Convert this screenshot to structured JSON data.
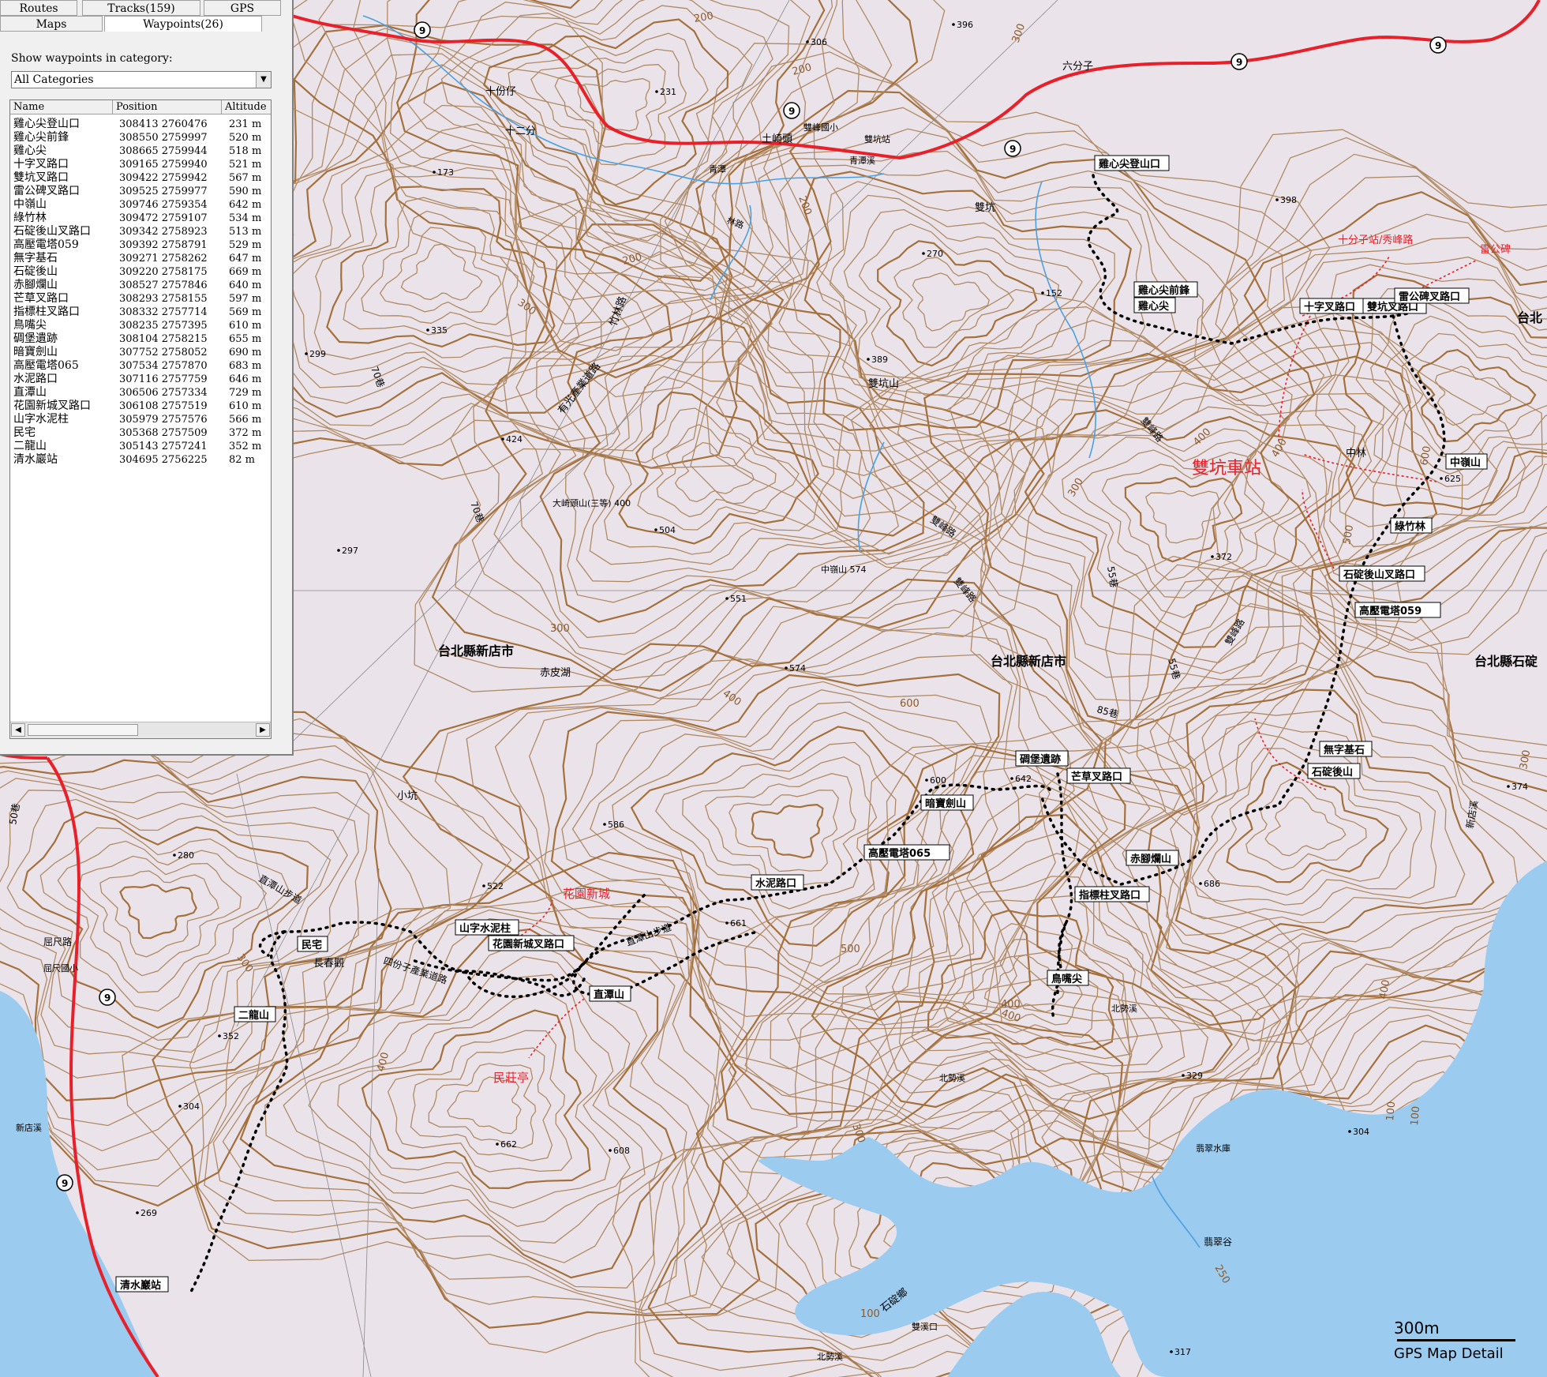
{
  "panel": {
    "tabs_row1": [
      "Routes",
      "Tracks(159)",
      "GPS"
    ],
    "tabs_row2": [
      "Maps",
      "Waypoints(26)"
    ],
    "category_label": "Show waypoints in category:",
    "category_value": "All Categories",
    "columns": [
      "Name",
      "Position",
      "Altitude"
    ],
    "waypoints": [
      {
        "name": "雞心尖登山口",
        "position": "308413 2760476",
        "altitude": "231 m"
      },
      {
        "name": "雞心尖前鋒",
        "position": "308550 2759997",
        "altitude": "520 m"
      },
      {
        "name": "雞心尖",
        "position": "308665 2759944",
        "altitude": "518 m"
      },
      {
        "name": "十字叉路口",
        "position": "309165 2759940",
        "altitude": "521 m"
      },
      {
        "name": "雙坑叉路口",
        "position": "309422 2759942",
        "altitude": "567 m"
      },
      {
        "name": "雷公碑叉路口",
        "position": "309525 2759977",
        "altitude": "590 m"
      },
      {
        "name": "中嶺山",
        "position": "309746 2759354",
        "altitude": "642 m"
      },
      {
        "name": "綠竹林",
        "position": "309472 2759107",
        "altitude": "534 m"
      },
      {
        "name": "石碇後山叉路口",
        "position": "309342 2758923",
        "altitude": "513 m"
      },
      {
        "name": "高壓電塔059",
        "position": "309392 2758791",
        "altitude": "529 m"
      },
      {
        "name": "無字基石",
        "position": "309271 2758262",
        "altitude": "647 m"
      },
      {
        "name": "石碇後山",
        "position": "309220 2758175",
        "altitude": "669 m"
      },
      {
        "name": "赤腳爛山",
        "position": "308527 2757846",
        "altitude": "640 m"
      },
      {
        "name": "芒草叉路口",
        "position": "308293 2758155",
        "altitude": "597 m"
      },
      {
        "name": "指標柱叉路口",
        "position": "308332 2757714",
        "altitude": "569 m"
      },
      {
        "name": "鳥嘴尖",
        "position": "308235 2757395",
        "altitude": "610 m"
      },
      {
        "name": "碉堡遺跡",
        "position": "308104 2758215",
        "altitude": "655 m"
      },
      {
        "name": "暗寶劍山",
        "position": "307752 2758052",
        "altitude": "690 m"
      },
      {
        "name": "高壓電塔065",
        "position": "307534 2757870",
        "altitude": "683 m"
      },
      {
        "name": "水泥路口",
        "position": "307116 2757759",
        "altitude": "646 m"
      },
      {
        "name": "直潭山",
        "position": "306506 2757334",
        "altitude": "729 m"
      },
      {
        "name": "花園新城叉路口",
        "position": "306108 2757519",
        "altitude": "610 m"
      },
      {
        "name": "山字水泥柱",
        "position": "305979 2757576",
        "altitude": "566 m"
      },
      {
        "name": "民宅",
        "position": "305368 2757509",
        "altitude": "372 m"
      },
      {
        "name": "二龍山",
        "position": "305143 2757241",
        "altitude": "352 m"
      },
      {
        "name": "清水巖站",
        "position": "304695 2756225",
        "altitude": "82 m"
      }
    ]
  },
  "map": {
    "colors": {
      "background": "#ebe3ea",
      "contour": "#b08a64",
      "contour_index": "#a4703c",
      "water": "#9ccbf0",
      "highway": "#e8202a",
      "stream": "#4aa0e0",
      "track": "#000000",
      "annotation": "#e8202a"
    },
    "route_shields": [
      "9",
      "9",
      "9",
      "9",
      "9",
      "9",
      "9"
    ],
    "waypoint_labels": [
      "雞心尖登山口",
      "雞心尖前鋒",
      "雞心尖",
      "十字叉路口",
      "雙坑叉路口",
      "雷公碑叉路口",
      "中嶺山",
      "綠竹林",
      "石碇後山叉路口",
      "高壓電塔059",
      "無字基石",
      "石碇後山",
      "赤腳爛山",
      "芒草叉路口",
      "指標柱叉路口",
      "鳥嘴尖",
      "碉堡遺跡",
      "暗寶劍山",
      "高壓電塔065",
      "水泥路口",
      "直潭山",
      "花園新城叉路口",
      "山字水泥柱",
      "民宅",
      "二龍山",
      "清水巖站"
    ],
    "annotations": [
      "雙坑車站",
      "十分子站/秀峰路",
      "雷公碑",
      "花園新城",
      "民莊亭"
    ],
    "place_names": [
      "台北縣新店市",
      "台北縣新店市",
      "台北縣石碇",
      "台北",
      "十份仔",
      "十二分",
      "土崎頭",
      "雙坑",
      "雙坑山",
      "中林",
      "赤皮湖",
      "小坑",
      "翡翠水庫",
      "翡翠谷",
      "北勢溪",
      "北勢溪",
      "北勢溪",
      "新店溪",
      "石碇鄉",
      "六分子",
      "屈尺路",
      "雙溪口",
      "長春觀",
      "直潭山步道",
      "直潭山步道",
      "四份子產業道路",
      "青潭",
      "青潭溪",
      "林路",
      "雙峰路",
      "雙峰路",
      "雙峰路",
      "雙峰路",
      "竹林路",
      "有光產業道路",
      "70巷",
      "70巷",
      "55巷",
      "55巷",
      "85巷",
      "50巷",
      "雙坑站",
      "雙峰國小",
      "中嶺山 574",
      "大崎頭山(三等) 400",
      "屈尺國小",
      "新店溪"
    ],
    "elevation_spots": [
      "396",
      "306",
      "231",
      "173",
      "398",
      "270",
      "152",
      "389",
      "335",
      "299",
      "424",
      "504",
      "297",
      "551",
      "574",
      "372",
      "374",
      "586",
      "522",
      "661",
      "686",
      "642",
      "600",
      "280",
      "352",
      "304",
      "329",
      "304",
      "662",
      "608",
      "269",
      "317",
      "625"
    ],
    "contour_labels": [
      "200",
      "200",
      "300",
      "200",
      "300",
      "300",
      "400",
      "300",
      "500",
      "600",
      "400",
      "400",
      "600",
      "500",
      "400",
      "400",
      "300",
      "300",
      "300",
      "400",
      "100",
      "100",
      "100",
      "250",
      "200",
      "400"
    ]
  },
  "scale": {
    "label": "300m",
    "caption": "GPS Map Detail"
  }
}
